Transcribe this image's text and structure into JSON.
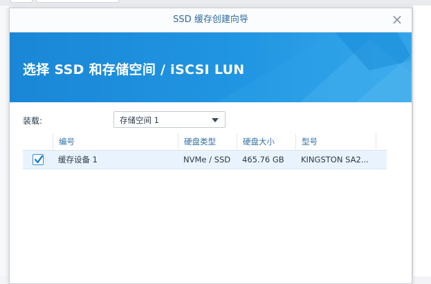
{
  "window": {
    "title": "SSD 缓存创建向导",
    "close_symbol": "×"
  },
  "banner": {
    "title": "选择 SSD 和存储空间 / iSCSI LUN"
  },
  "filter": {
    "label": "装载:",
    "selected": "存储空间 1"
  },
  "table": {
    "columns": [
      "编号",
      "硬盘类型",
      "硬盘大小",
      "型号"
    ],
    "rows": [
      {
        "checked": true,
        "number": "缓存设备 1",
        "type": "NVMe / SSD",
        "size": "465.76 GB",
        "model": "KINGSTON SA2..."
      }
    ]
  },
  "icons": {
    "close": "close-icon",
    "dropdown": "chevron-down-icon",
    "check": "checkmark-icon"
  },
  "colors": {
    "banner": "#1d8fdc",
    "accent": "#2f6fa8",
    "selected_row": "#e8f3fd"
  }
}
